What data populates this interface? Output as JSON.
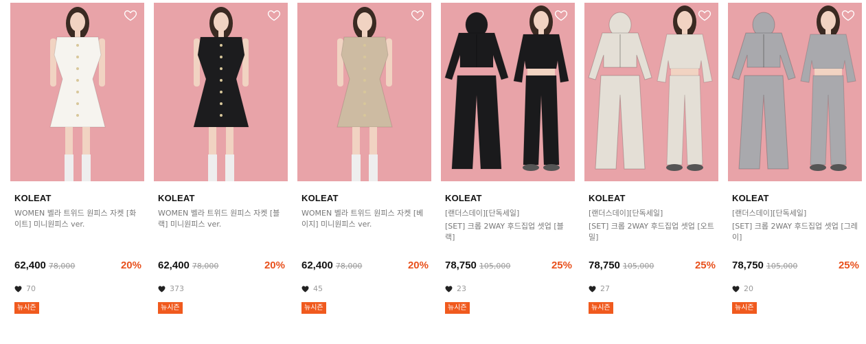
{
  "accent_color": "#e8501c",
  "badge_color": "#f05a1e",
  "products": [
    {
      "brand": "KOLEAT",
      "promo": "",
      "name": "WOMEN 벨라 트위드 원피스 자켓 [화이트] 미니원피스 ver.",
      "price": "62,400",
      "original_price": "78,000",
      "discount": "20%",
      "likes": "70",
      "badge": "뉴시즌",
      "image": {
        "kind": "dress",
        "garment_color": "#f6f4ef"
      }
    },
    {
      "brand": "KOLEAT",
      "promo": "",
      "name": "WOMEN 벨라 트위드 원피스 자켓 [블랙] 미니원피스 ver.",
      "price": "62,400",
      "original_price": "78,000",
      "discount": "20%",
      "likes": "373",
      "badge": "뉴시즌",
      "image": {
        "kind": "dress",
        "garment_color": "#1c1c1e"
      }
    },
    {
      "brand": "KOLEAT",
      "promo": "",
      "name": "WOMEN 벨라 트위드 원피스 자켓 [베이지] 미니원피스 ver.",
      "price": "62,400",
      "original_price": "78,000",
      "discount": "20%",
      "likes": "45",
      "badge": "뉴시즌",
      "image": {
        "kind": "dress",
        "garment_color": "#cdbba2"
      }
    },
    {
      "brand": "KOLEAT",
      "promo": "[랜더스데이][단독세일]",
      "name": "[SET] 크롭 2WAY 후드집업 셋업 [블랙]",
      "price": "78,750",
      "original_price": "105,000",
      "discount": "25%",
      "likes": "23",
      "badge": "뉴시즌",
      "image": {
        "kind": "setup",
        "garment_color": "#1a1a1c"
      }
    },
    {
      "brand": "KOLEAT",
      "promo": "[랜더스데이][단독세일]",
      "name": "[SET] 크롭 2WAY 후드집업 셋업 [오트밀]",
      "price": "78,750",
      "original_price": "105,000",
      "discount": "25%",
      "likes": "27",
      "badge": "뉴시즌",
      "image": {
        "kind": "setup",
        "garment_color": "#e4dfd6"
      }
    },
    {
      "brand": "KOLEAT",
      "promo": "[랜더스데이][단독세일]",
      "name": "[SET] 크롭 2WAY 후드집업 셋업 [그레이]",
      "price": "78,750",
      "original_price": "105,000",
      "discount": "25%",
      "likes": "20",
      "badge": "뉴시즌",
      "image": {
        "kind": "setup",
        "garment_color": "#a9a9ad"
      }
    }
  ]
}
